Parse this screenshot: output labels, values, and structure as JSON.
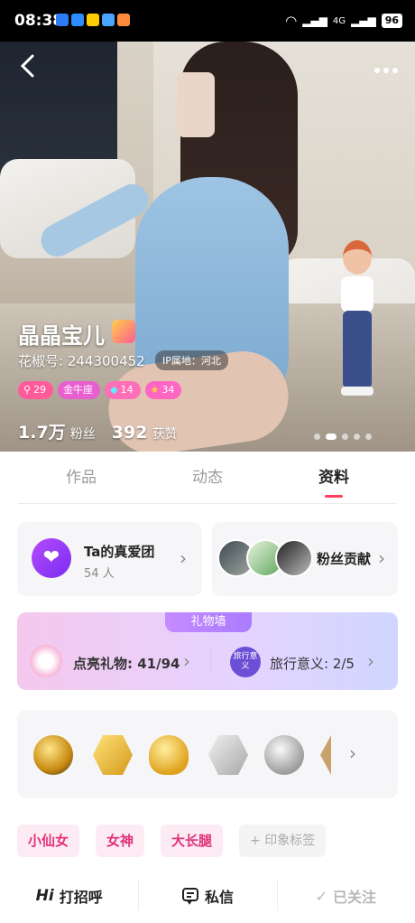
{
  "status_bar": {
    "time": "08:38",
    "battery": "96",
    "network": "4G"
  },
  "hero": {
    "name": "晶晶宝儿",
    "id_label": "花椒号: 244300452",
    "ip_label": "IP属地：河北",
    "badges": [
      {
        "text": "29",
        "icon": "search-icon",
        "color": "#ff5b9a"
      },
      {
        "text": "金牛座",
        "icon": "",
        "color": "#e85fd0"
      },
      {
        "text": "14",
        "icon": "diamond-icon",
        "color": "#ff6fb7"
      },
      {
        "text": "34",
        "icon": "star-icon",
        "color": "#ff66c4"
      }
    ],
    "fans_value": "1.7万",
    "fans_label": "粉丝",
    "likes_value": "392",
    "likes_label": "获赞",
    "carousel_pages": 5,
    "carousel_active": 2
  },
  "tabs": [
    {
      "label": "作品",
      "active": false
    },
    {
      "label": "动态",
      "active": false
    },
    {
      "label": "资料",
      "active": true
    }
  ],
  "fan_club": {
    "title": "Ta的真爱团",
    "count": "54 人"
  },
  "fan_contribution": {
    "title": "粉丝贡献"
  },
  "gift_wall": {
    "title": "礼物墙",
    "lit_gifts": "点亮礼物: 41/94",
    "travel": "旅行意义: 2/5",
    "travel_icon_text": "旅行意义"
  },
  "tags": [
    "小仙女",
    "女神",
    "大长腿"
  ],
  "add_tag_label": "+ 印象标签",
  "bottom_bar": {
    "greet": "打招呼",
    "greet_prefix": "Hi",
    "message": "私信",
    "follow": "已关注"
  }
}
